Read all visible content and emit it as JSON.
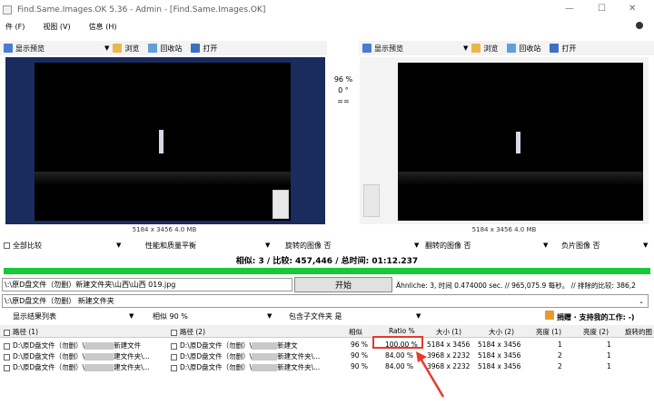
{
  "window": {
    "title": "Find.Same.Images.OK 5.36 - Admin - [Find.Same.Images.OK]",
    "min": "—",
    "max": "☐",
    "close": "✕"
  },
  "menu": [
    "件 (F)",
    "视图 (V)",
    "信息 (H)"
  ],
  "left_toolbar": {
    "preview": "显示预览",
    "browse": "浏览",
    "recycle": "回收站",
    "open": "打开"
  },
  "right_toolbar": {
    "preview": "显示预览",
    "browse": "浏览",
    "recycle": "回收站",
    "open": "打开"
  },
  "center_info": {
    "percent": "96 %",
    "degree": "0 °",
    "eq": "=="
  },
  "left_image_info": "5184 x 3456 4.0 MB",
  "right_image_info": "5184 x 3456 4.0 MB",
  "options_row": {
    "compare": "全部比较",
    "balance": "性能和质量平衡",
    "rotated": "旋转的图像 否",
    "flipped": "翻转的图像 否",
    "negative": "负片图像 否"
  },
  "status": "相似: 3 / 比较: 457,446 / 总时间: 01:12.237",
  "path_field": "\\:\\原D盘文件（勿删）新建文件夹\\山西\\山西 019.jpg",
  "start_button": "开始",
  "stats": "Ähnliche: 3, 时间 0.474000 sec. // 965,075.9 每秒。 // 排除的比较: 386,2",
  "folder_field": "\\:\\原D盘文件（勿删） 新建文件夹",
  "filter_row": {
    "list": "显示结果列表",
    "similar": "相似 90 %",
    "subfolders": "包含子文件夹 是",
    "donate": "捐赠 · 支持我的工作: -)"
  },
  "columns": [
    "路径 (1)",
    "路径 (2)",
    "相似",
    "Ratio %",
    "大小 (1)",
    "大小 (2)",
    "亮度 (1)",
    "亮度 (2)",
    "旋转的图"
  ],
  "rows": [
    {
      "p1a": "D:\\原D盘文件（勿删）\\",
      "p1b": "新建文件",
      "p2a": "D:\\原D盘文件（勿删）\\",
      "p2b": "新建文",
      "sim": "96 %",
      "ratio": "100.00 %",
      "s1": "5184 x 3456",
      "s2": "5184 x 3456",
      "b1": "1",
      "b2": "1"
    },
    {
      "p1a": "D:\\原D盘文件（勿删）\\",
      "p1b": "建文件夹\\...",
      "p2a": "D:\\原D盘文件（勿删）\\",
      "p2b": "新建文件夹\\...",
      "sim": "90 %",
      "ratio": "84.00 %",
      "s1": "3968 x 2232",
      "s2": "5184 x 3456",
      "b1": "2",
      "b2": "1"
    },
    {
      "p1a": "D:\\原D盘文件（勿删）\\",
      "p1b": "建文件夹\\...",
      "p2a": "D:\\原D盘文件（勿删）\\",
      "p2b": "新建文件夹\\...",
      "sim": "90 %",
      "ratio": "84.00 %",
      "s1": "3968 x 2232",
      "s2": "5184 x 3456",
      "b1": "2",
      "b2": "1"
    }
  ],
  "colors": {
    "image_bg": "#1a2b5e",
    "progress": "#16c936",
    "highlight": "#e53a2f"
  },
  "progress": 1.0
}
